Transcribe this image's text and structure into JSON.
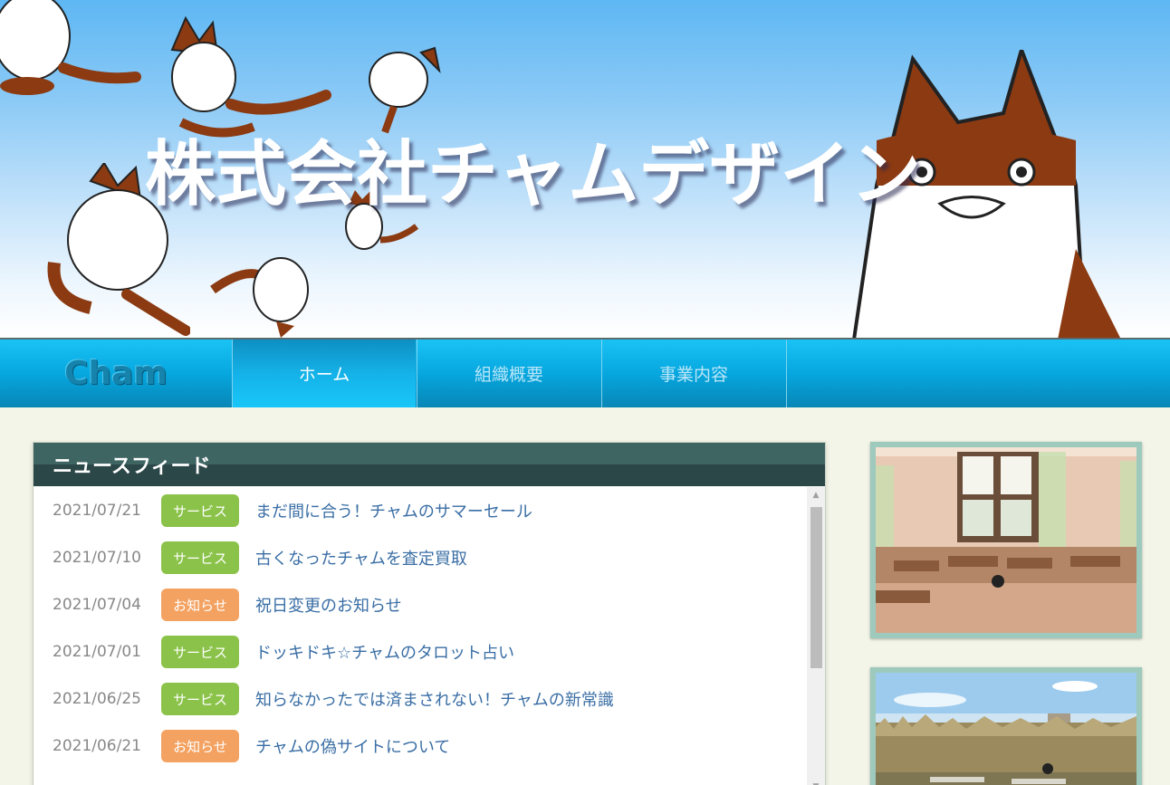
{
  "header": {
    "site_title": "株式会社チャムデザイン"
  },
  "nav": {
    "logo": "Cham",
    "items": [
      {
        "label": "ホーム",
        "active": true
      },
      {
        "label": "組織概要",
        "active": false
      },
      {
        "label": "事業内容",
        "active": false
      }
    ]
  },
  "news": {
    "title": "ニュースフィード",
    "items": [
      {
        "date": "2021/07/21",
        "category": "サービス",
        "type": "service",
        "title": "まだ間に合う！チャムのサマーセール"
      },
      {
        "date": "2021/07/10",
        "category": "サービス",
        "type": "service",
        "title": "古くなったチャムを査定買取"
      },
      {
        "date": "2021/07/04",
        "category": "お知らせ",
        "type": "notice",
        "title": "祝日変更のお知らせ"
      },
      {
        "date": "2021/07/01",
        "category": "サービス",
        "type": "service",
        "title": "ドッキドキ☆チャムのタロット占い"
      },
      {
        "date": "2021/06/25",
        "category": "サービス",
        "type": "service",
        "title": "知らなかったでは済まされない！チャムの新常識"
      },
      {
        "date": "2021/06/21",
        "category": "お知らせ",
        "type": "notice",
        "title": "チャムの偽サイトについて"
      }
    ]
  },
  "colors": {
    "service_badge": "#8bc34a",
    "notice_badge": "#f4a261",
    "nav_active": "#14b2e8",
    "news_header": "#3f6563",
    "link": "#3a6ea5"
  }
}
